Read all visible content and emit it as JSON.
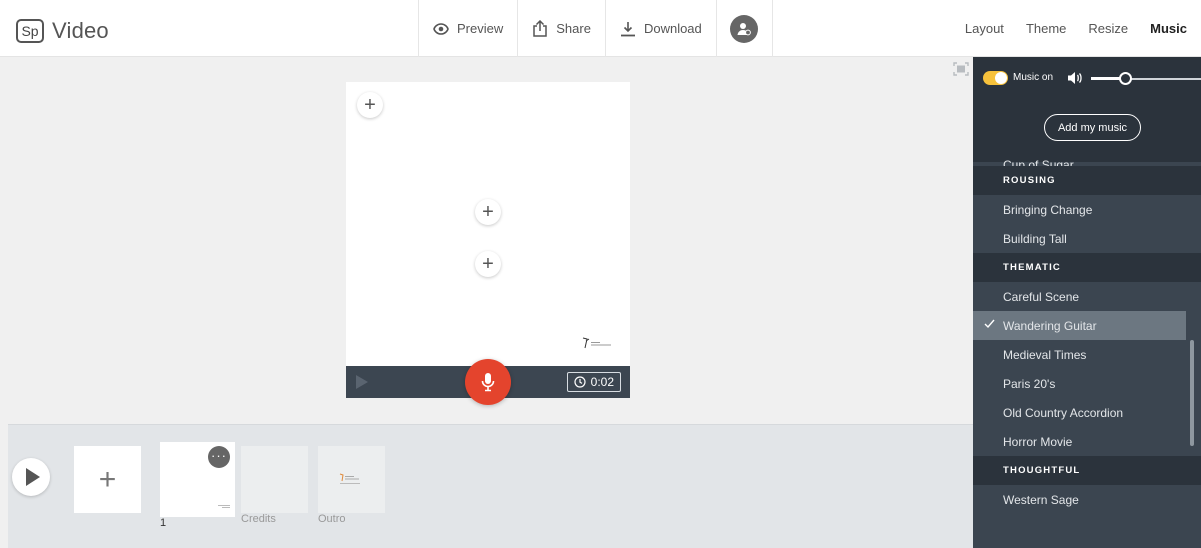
{
  "app": {
    "badge": "Sp",
    "name": "Video"
  },
  "toolbar": {
    "preview": "Preview",
    "share": "Share",
    "download": "Download"
  },
  "tabs": [
    {
      "label": "Layout",
      "active": false
    },
    {
      "label": "Theme",
      "active": false
    },
    {
      "label": "Resize",
      "active": false
    },
    {
      "label": "Music",
      "active": true
    }
  ],
  "player": {
    "duration": "0:02"
  },
  "timeline": {
    "slide_number": "1",
    "credits_label": "Credits",
    "outro_label": "Outro",
    "more_glyph": "···"
  },
  "music": {
    "toggle_label": "Music on",
    "toggle_on": true,
    "volume": 0.3,
    "add_button": "Add my music",
    "partial_item": "Cup of Sugar",
    "sections": [
      {
        "title": "ROUSING",
        "items": [
          "Bringing Change",
          "Building Tall"
        ]
      },
      {
        "title": "THEMATIC",
        "items": [
          "Careful Scene",
          "Wandering Guitar",
          "Medieval Times",
          "Paris 20's",
          "Old Country Accordion",
          "Horror Movie"
        ]
      },
      {
        "title": "THOUGHTFUL",
        "items": [
          "Western Sage"
        ]
      }
    ],
    "selected": "Wandering Guitar"
  },
  "colors": {
    "accent_toggle": "#f7c23c",
    "mic": "#e4442d",
    "panel": "#3b4550",
    "panel_dark": "#2b333c",
    "selected_row": "#6c7781"
  },
  "icons": [
    "eye-icon",
    "share-icon",
    "download-icon",
    "user-icon",
    "fit-screen-icon",
    "plus-icon",
    "microphone-icon",
    "clock-icon",
    "play-icon",
    "speaker-icon",
    "check-icon"
  ]
}
